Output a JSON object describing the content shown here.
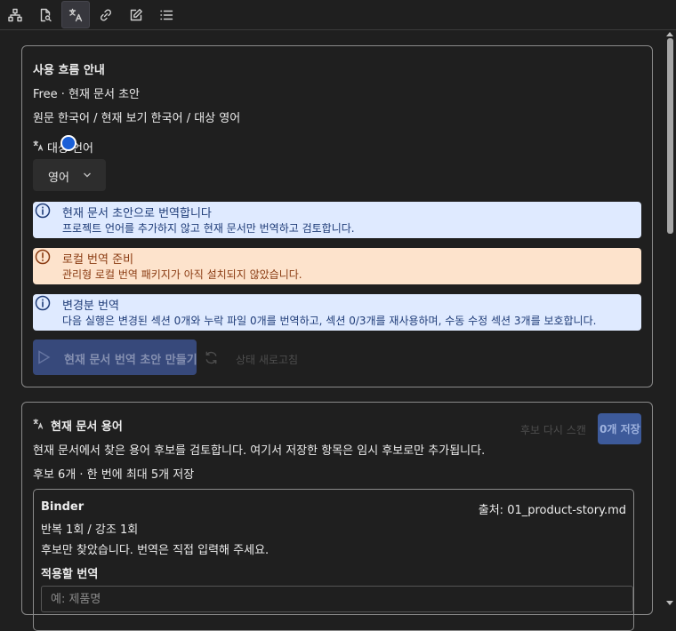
{
  "toolbar": {
    "items": [
      {
        "icon": "sitemap-icon"
      },
      {
        "icon": "file-search-icon"
      },
      {
        "icon": "translate-icon",
        "active": true
      },
      {
        "icon": "link-icon"
      },
      {
        "icon": "edit-icon"
      },
      {
        "icon": "list-icon"
      }
    ]
  },
  "workflow": {
    "title": "사용 흐름 안내",
    "plan_line": "Free · 현재 문서 초안",
    "lang_line": "원문 한국어 / 현재 보기 한국어 / 대상 영어",
    "target_label": "대상 언어",
    "target_value": "영어",
    "notices": [
      {
        "kind": "info",
        "title": "현재 문서 초안으로 번역합니다",
        "body": "프로젝트 언어를 추가하지 않고 현재 문서만 번역하고 검토합니다."
      },
      {
        "kind": "warn",
        "title": "로컬 번역 준비",
        "body": "관리형 로컬 번역 패키지가 아직 설치되지 않았습니다."
      },
      {
        "kind": "info",
        "title": "변경분 번역",
        "body": "다음 실행은 변경된 섹션 0개와 누락 파일 0개를 번역하고, 섹션 0/3개를 재사용하며, 수동 수정 섹션 3개를 보호합니다."
      }
    ],
    "run_button": "현재 문서 번역 초안 만들기",
    "refresh_label": "상태 새로고침"
  },
  "terms": {
    "title": "현재 문서 용어",
    "rescan_label": "후보 다시 스캔",
    "save_label": "0개 저장",
    "description": "현재 문서에서 찾은 용어 후보를 검토합니다. 여기서 저장한 항목은 임시 후보로만 추가됩니다.",
    "count_line": "후보 6개 · 한 번에 최대 5개 저장",
    "candidate": {
      "term": "Binder",
      "source": "출처: 01_product-story.md",
      "stats": "반복 1회 / 강조 1회",
      "note": "후보만 찾았습니다. 번역은 직접 입력해 주세요.",
      "field_label": "적용할 번역",
      "placeholder": "예: 제품명"
    }
  },
  "colors": {
    "background": "#1f1f1f",
    "info_bg": "#dfeaff",
    "warn_bg": "#fde3cc",
    "primary": "#3a4e86"
  }
}
